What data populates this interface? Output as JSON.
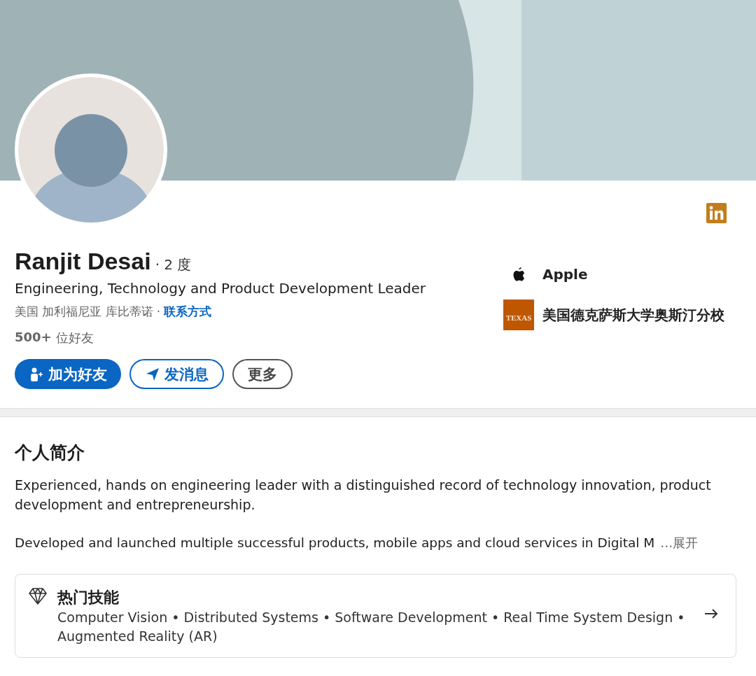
{
  "profile": {
    "name": "Ranjit Desai",
    "degree": "· 2 度",
    "headline": "Engineering, Technology and Product Development Leader",
    "location": "美国 加利福尼亚 库比蒂诺",
    "separator": "·",
    "contact_link": "联系方式",
    "connections_count": "500+",
    "connections_label": "位好友",
    "buttons": [
      {
        "label": "加为好友",
        "kind": "primary"
      },
      {
        "label": "发消息",
        "kind": "secondary"
      },
      {
        "label": "更多",
        "kind": "tertiary"
      }
    ],
    "affiliations": [
      {
        "kind": "company",
        "name": "Apple"
      },
      {
        "kind": "school",
        "name": "美国德克萨斯大学奥斯汀分校",
        "logo_text": "TEXAS"
      }
    ]
  },
  "about": {
    "title": "个人简介",
    "paragraphs": [
      "Experienced, hands on engineering leader with a distinguished record of technology innovation, product development and entrepreneurship.",
      "Developed and launched multiple successful products, mobile apps and cloud services in Digital M"
    ],
    "expand": "…展开"
  },
  "top_skills": {
    "title": "热门技能",
    "skills": "Computer Vision • Distributed Systems • Software Development • Real Time System Design • Augmented Reality (AR)"
  }
}
